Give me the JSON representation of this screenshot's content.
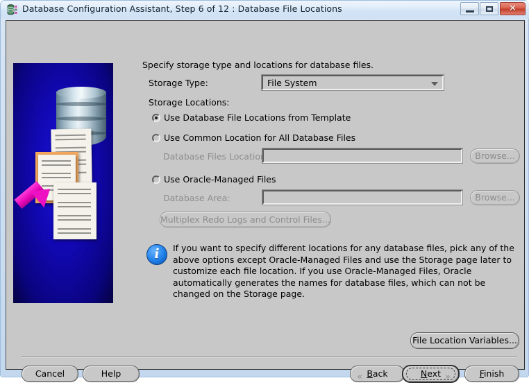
{
  "window": {
    "title": "Database Configuration Assistant, Step 6 of 12 : Database File Locations",
    "icon": "database-app-icon",
    "controls": {
      "minimize": "minimize-icon",
      "maximize": "maximize-icon",
      "close": "✕"
    }
  },
  "banner": {
    "alt": "database-file-locations-illustration"
  },
  "form": {
    "intro": "Specify storage type and locations for database files.",
    "storage_type_label": "Storage Type:",
    "storage_type_value": "File System",
    "storage_type_options": [
      "File System"
    ],
    "storage_locations_label": "Storage Locations:",
    "options": [
      {
        "label": "Use Database File Locations from Template",
        "selected": true
      },
      {
        "label": "Use Common Location for All Database Files",
        "selected": false,
        "field_label": "Database Files Location:",
        "field_value": "",
        "browse_label": "Browse..."
      },
      {
        "label": "Use Oracle-Managed Files",
        "selected": false,
        "field_label": "Database Area:",
        "field_value": "",
        "browse_label": "Browse..."
      }
    ],
    "multiplex_label": "Multiplex Redo Logs and Control Files...",
    "info_icon": "info-icon",
    "info_text": "If you want to specify different locations for any database files, pick any of the above options except Oracle-Managed Files and use the Storage page later to customize each file location. If you use Oracle-Managed Files, Oracle automatically generates the names for database files, which can not be changed on the Storage page.",
    "file_location_variables_label": "File Location Variables..."
  },
  "footer": {
    "cancel_label": "Cancel",
    "help_label": "Help",
    "back_label": "Back",
    "back_mnemonic": "B",
    "next_label": "Next",
    "next_mnemonic": "N",
    "finish_label": "Finish",
    "finish_mnemonic": "F",
    "back_chevron": "«",
    "next_chevron": "»"
  },
  "colors": {
    "panel": "#c8c8c8",
    "title_gradient_top": "#eef5fc",
    "close_button": "#bf3a27",
    "banner_blue": "#1208b4",
    "arrow_magenta": "#ee11c4",
    "info_blue": "#1f7fe8",
    "disabled_text": "#8d8d8d"
  }
}
